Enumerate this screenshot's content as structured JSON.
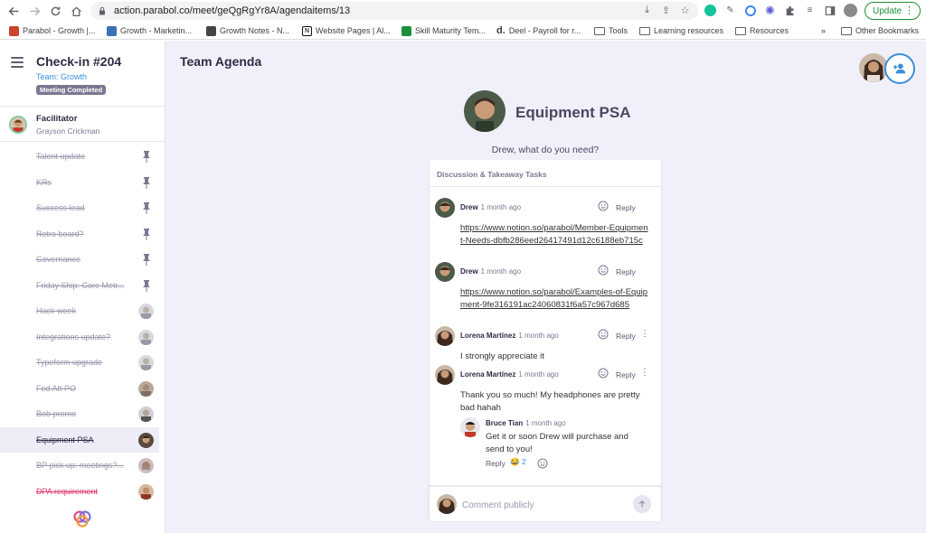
{
  "browser": {
    "url": "action.parabol.co/meet/geQgRgYr8A/agendaitems/13",
    "update_label": "Update",
    "bookmarks": [
      {
        "label": "Parabol - Growth |..."
      },
      {
        "label": "Growth - Marketin..."
      },
      {
        "label": "Growth Notes - N..."
      },
      {
        "label": "Website Pages | Al..."
      },
      {
        "label": "Skill Maturity Tem..."
      },
      {
        "label": "Deel - Payroll for r..."
      },
      {
        "label": "Tools"
      },
      {
        "label": "Learning resources"
      },
      {
        "label": "Resources"
      }
    ],
    "more_bookmarks": "»",
    "other_bookmarks": "Other Bookmarks"
  },
  "sidebar": {
    "meeting_title": "Check-in #204",
    "team": "Team: Growth",
    "status": "Meeting Completed",
    "facilitator_label": "Facilitator",
    "facilitator_name": "Grayson Crickman",
    "items": [
      {
        "label": "Talent update",
        "marker": "pin"
      },
      {
        "label": "KRs",
        "marker": "pin"
      },
      {
        "label": "Success lead",
        "marker": "pin"
      },
      {
        "label": "Retro board?",
        "marker": "pin"
      },
      {
        "label": "Governance",
        "marker": "pin"
      },
      {
        "label": "Friday Ship: Core Metr...",
        "marker": "pin"
      },
      {
        "label": "Hack week",
        "marker": "avatar"
      },
      {
        "label": "Integrations update?",
        "marker": "avatar"
      },
      {
        "label": "Typeform upgrade",
        "marker": "avatar"
      },
      {
        "label": "Fed Att PO",
        "marker": "avatar"
      },
      {
        "label": "Bob promo",
        "marker": "avatar"
      },
      {
        "label": "Equipment PSA",
        "marker": "avatar",
        "active": true
      },
      {
        "label": "BP pick up: meetings?...",
        "marker": "avatar"
      },
      {
        "label": "DPA requirement",
        "marker": "avatar",
        "warn": true
      }
    ]
  },
  "main": {
    "heading": "Team Agenda",
    "item_title": "Equipment PSA",
    "question": "Drew, what do you need?",
    "section_title": "Discussion & Takeaway Tasks",
    "comments": [
      {
        "author": "Drew",
        "time": "1 month ago",
        "reply": "Reply",
        "link": "https://www.notion.so/parabol/Member-Equipment-Needs-dbfb286eed26417491d12c6188eb715c"
      },
      {
        "author": "Drew",
        "time": "1 month ago",
        "reply": "Reply",
        "link": "https://www.notion.so/parabol/Examples-of-Equipment-9fe316191ac24060831f6a57c967d685"
      },
      {
        "author": "Lorena Martínez",
        "time": "1 month ago",
        "reply": "Reply",
        "text": "I strongly appreciate it"
      },
      {
        "author": "Lorena Martínez",
        "time": "1 month ago",
        "reply": "Reply",
        "text": "Thank you so much! My headphones are pretty bad hahah"
      }
    ],
    "thread_reply": {
      "author": "Bruce Tian",
      "time": "1 month ago",
      "text": "Get it or soon Drew will purchase and send to you!",
      "reply": "Reply",
      "reaction_emoji": "😂",
      "reaction_count": "2"
    },
    "composer_placeholder": "Comment publicly"
  },
  "colors": {
    "accent": "#3a8fd8",
    "background": "#f1f0fa",
    "warn": "#e2336e"
  }
}
